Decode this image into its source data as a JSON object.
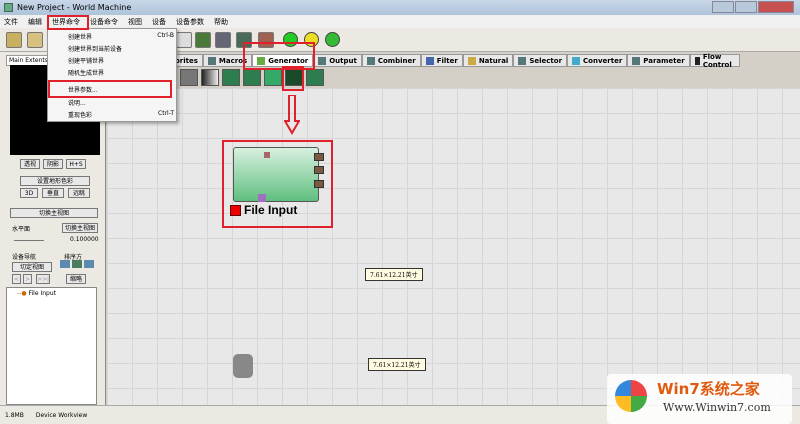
{
  "window": {
    "title": "New Project - World Machine"
  },
  "menubar": [
    "文件",
    "编辑",
    "世界命令",
    "设备命令",
    "视图",
    "设备",
    "设备参数",
    "帮助"
  ],
  "world_menu": [
    {
      "label": "创建世界",
      "shortcut": "Ctrl-B"
    },
    {
      "label": "创建世界到当前设备",
      "shortcut": ""
    },
    {
      "label": "创建平铺世界",
      "shortcut": ""
    },
    {
      "label": "随机生成世界",
      "shortcut": ""
    },
    {
      "label": "世界参数...",
      "shortcut": ""
    },
    {
      "label": "说明...",
      "shortcut": ""
    },
    {
      "label": "重现色彩",
      "shortcut": "Ctrl-T"
    }
  ],
  "left": {
    "tab": "Main Extents",
    "view_btns": [
      "透视",
      "阴影",
      "H+S"
    ],
    "terrain_color": "设置地形色彩",
    "view3": [
      "3D",
      "垂直",
      "远眺"
    ],
    "toggle_main": "切换主视图",
    "water_label": "水平面",
    "water_btn": "切换主视图",
    "water_value": "0.100000",
    "nav_label": "设备导航",
    "sort_label": "排序方",
    "lock_view": "切定视图",
    "nav_btns": [
      "<",
      ">",
      ">>|"
    ],
    "thumb": "缩略",
    "tree": [
      "File Input"
    ]
  },
  "tabs": [
    {
      "label": "orites"
    },
    {
      "label": "Macros"
    },
    {
      "label": "Generator",
      "active": true
    },
    {
      "label": "Output"
    },
    {
      "label": "Combiner"
    },
    {
      "label": "Filter"
    },
    {
      "label": "Natural"
    },
    {
      "label": "Selector"
    },
    {
      "label": "Converter"
    },
    {
      "label": "Parameter"
    },
    {
      "label": "Flow Control"
    }
  ],
  "node": {
    "label": "File Input",
    "accent": "#e00000"
  },
  "notes": [
    "7.61×12.21英寸",
    "7.61×12.21英寸"
  ],
  "status": {
    "memory": "1.8MB",
    "view": "Device Workview"
  },
  "watermark": {
    "brand": "Win7系统之家",
    "url": "Www.Winwin7.com"
  },
  "highlight_color": "#e0202a"
}
